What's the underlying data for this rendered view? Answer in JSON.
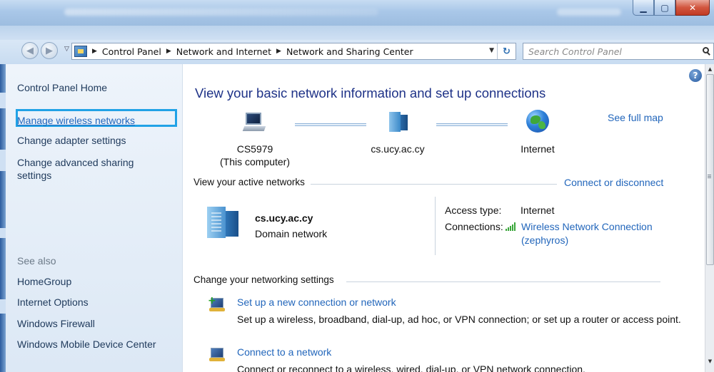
{
  "window": {
    "title": "Control Panel ▸ Network and Internet ▸ Manage Wireless Networks"
  },
  "address_bar": {
    "breadcrumb": [
      "Control Panel",
      "Network and Internet",
      "Network and Sharing Center"
    ],
    "search_placeholder": "Search Control Panel"
  },
  "sidebar": {
    "home": "Control Panel Home",
    "links": [
      "Manage wireless networks",
      "Change adapter settings",
      "Change advanced sharing",
      "settings"
    ],
    "see_also_heading": "See also",
    "see_also": [
      "HomeGroup",
      "Internet Options",
      "Windows Firewall",
      "Windows Mobile Device Center"
    ]
  },
  "main": {
    "heading": "View your basic network information and set up connections",
    "see_full_map": "See full map",
    "map": {
      "computer_name": "CS5979",
      "computer_note": "(This computer)",
      "domain": "cs.ucy.ac.cy",
      "internet": "Internet"
    },
    "active_networks_label": "View your active networks",
    "connect_or_disconnect": "Connect or disconnect",
    "active_network": {
      "name": "cs.ucy.ac.cy",
      "type": "Domain network",
      "access_type_label": "Access type:",
      "access_type_value": "Internet",
      "connections_label": "Connections:",
      "connection_name": "Wireless Network Connection",
      "connection_ssid": "(zephyros)"
    },
    "change_settings_label": "Change your networking settings",
    "tasks": [
      {
        "title": "Set up a new connection or network",
        "description": "Set up a wireless, broadband, dial-up, ad hoc, or VPN connection; or set up a router or access point."
      },
      {
        "title": "Connect to a network",
        "description": "Connect or reconnect to a wireless, wired, dial-up, or VPN network connection."
      }
    ]
  },
  "colors": {
    "link": "#2266bb",
    "heading": "#1e3287",
    "highlight_box": "#21a2e6"
  }
}
